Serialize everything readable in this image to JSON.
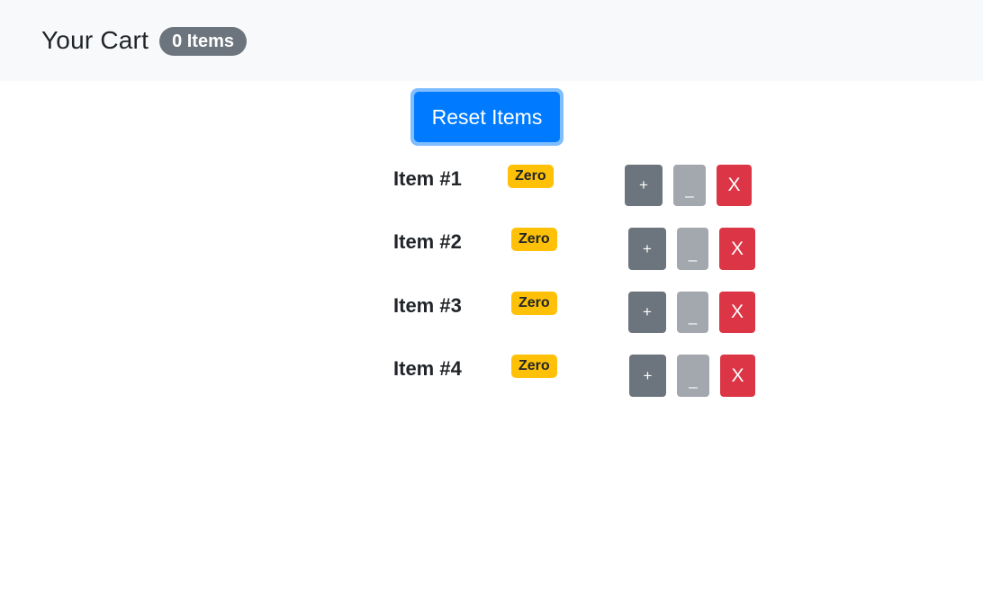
{
  "header": {
    "title": "Your Cart",
    "count_badge": "0 Items"
  },
  "reset_label": "Reset Items",
  "items": [
    {
      "label": "Item #1",
      "badge": "Zero",
      "plus": "+",
      "minus": "_",
      "remove": "X"
    },
    {
      "label": "Item #2",
      "badge": "Zero",
      "plus": "+",
      "minus": "_",
      "remove": "X"
    },
    {
      "label": "Item #3",
      "badge": "Zero",
      "plus": "+",
      "minus": "_",
      "remove": "X"
    },
    {
      "label": "Item #4",
      "badge": "Zero",
      "plus": "+",
      "minus": "_",
      "remove": "X"
    }
  ],
  "colors": {
    "navbar_bg": "#f8f9fa",
    "primary": "#007bff",
    "secondary": "#6c757d",
    "warning": "#ffc107",
    "danger": "#dc3545"
  }
}
